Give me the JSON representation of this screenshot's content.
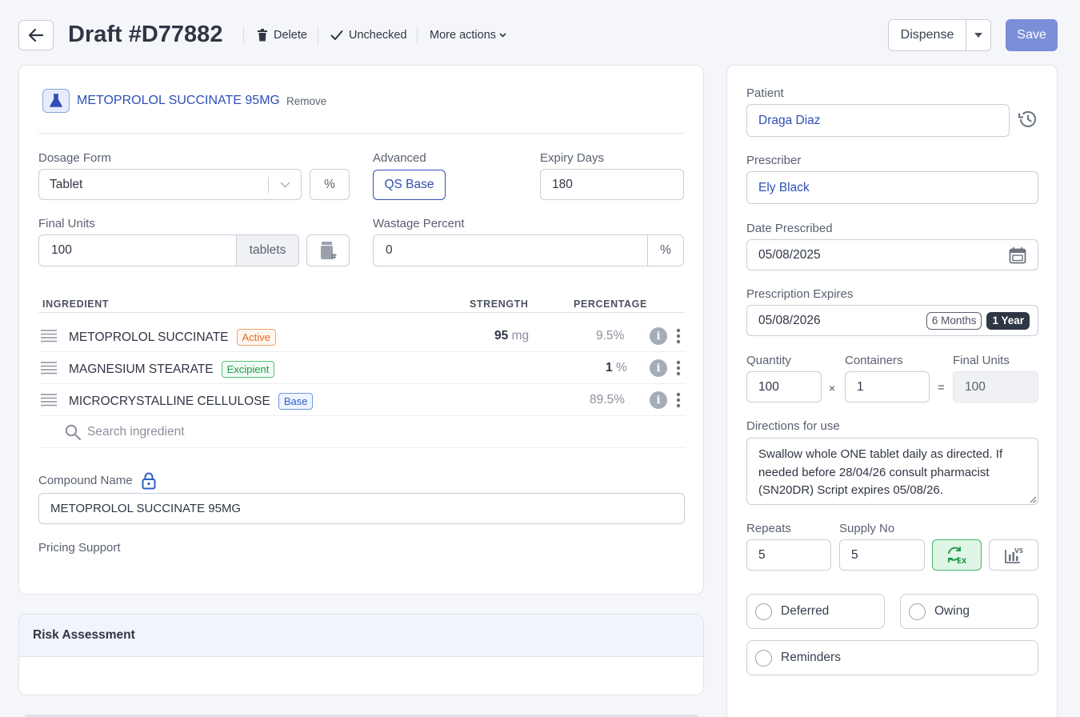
{
  "header": {
    "title": "Draft #D77882",
    "delete_label": "Delete",
    "status_label": "Unchecked",
    "more_actions_label": "More actions",
    "dispense_label": "Dispense",
    "save_label": "Save"
  },
  "product": {
    "name": "METOPROLOL SUCCINATE 95MG",
    "separator": "•",
    "remove_label": "Remove"
  },
  "form": {
    "dosage_form_label": "Dosage Form",
    "dosage_form_value": "Tablet",
    "percent_button": "%",
    "advanced_label": "Advanced",
    "qs_base_label": "QS Base",
    "expiry_days_label": "Expiry Days",
    "expiry_days_value": "180",
    "final_units_label": "Final Units",
    "final_units_value": "100",
    "final_units_suffix": "tablets",
    "wastage_label": "Wastage Percent",
    "wastage_value": "0",
    "wastage_suffix": "%"
  },
  "ingredients": {
    "headers": {
      "ingredient": "INGREDIENT",
      "strength": "STRENGTH",
      "percentage": "PERCENTAGE"
    },
    "rows": [
      {
        "name": "METOPROLOL SUCCINATE",
        "badge": "Active",
        "strength": "95",
        "unit": "mg",
        "percentage": "9.5%"
      },
      {
        "name": "MAGNESIUM STEARATE",
        "badge": "Excipient",
        "strength": "1",
        "unit": "%",
        "percentage": ""
      },
      {
        "name": "MICROCRYSTALLINE CELLULOSE",
        "badge": "Base",
        "strength": "",
        "unit": "",
        "percentage": "89.5%"
      }
    ],
    "search_placeholder": "Search ingredient"
  },
  "compound": {
    "label": "Compound Name",
    "value": "METOPROLOL SUCCINATE 95MG",
    "pricing_label": "Pricing Support"
  },
  "risk": {
    "title": "Risk Assessment"
  },
  "sidebar": {
    "patient_label": "Patient",
    "patient_value": "Draga Diaz",
    "prescriber_label": "Prescriber",
    "prescriber_value": "Ely Black",
    "date_prescribed_label": "Date Prescribed",
    "date_prescribed_value": "05/08/2025",
    "expires_label": "Prescription Expires",
    "expires_value": "05/08/2026",
    "expires_opt1": "6 Months",
    "expires_opt2": "1 Year",
    "quantity_label": "Quantity",
    "quantity_value": "100",
    "times": "×",
    "containers_label": "Containers",
    "containers_value": "1",
    "equals": "=",
    "final_units_label": "Final Units",
    "final_units_value": "100",
    "directions_label": "Directions for use",
    "directions_value": "Swallow whole ONE tablet daily as directed. If needed before 28/04/26 consult pharmacist (SN20DR) Script expires 05/08/26.",
    "repeats_label": "Repeats",
    "repeats_value": "5",
    "supply_label": "Supply No",
    "supply_value": "5",
    "deferred_label": "Deferred",
    "owing_label": "Owing",
    "reminders_label": "Reminders"
  },
  "colors": {
    "accent": "#2f4fb5",
    "save_bg": "#7b8fd8",
    "active": "#e56a1c",
    "excipient": "#1f9a47",
    "base": "#2f5fc8",
    "green_btn": "#dff6e6"
  }
}
